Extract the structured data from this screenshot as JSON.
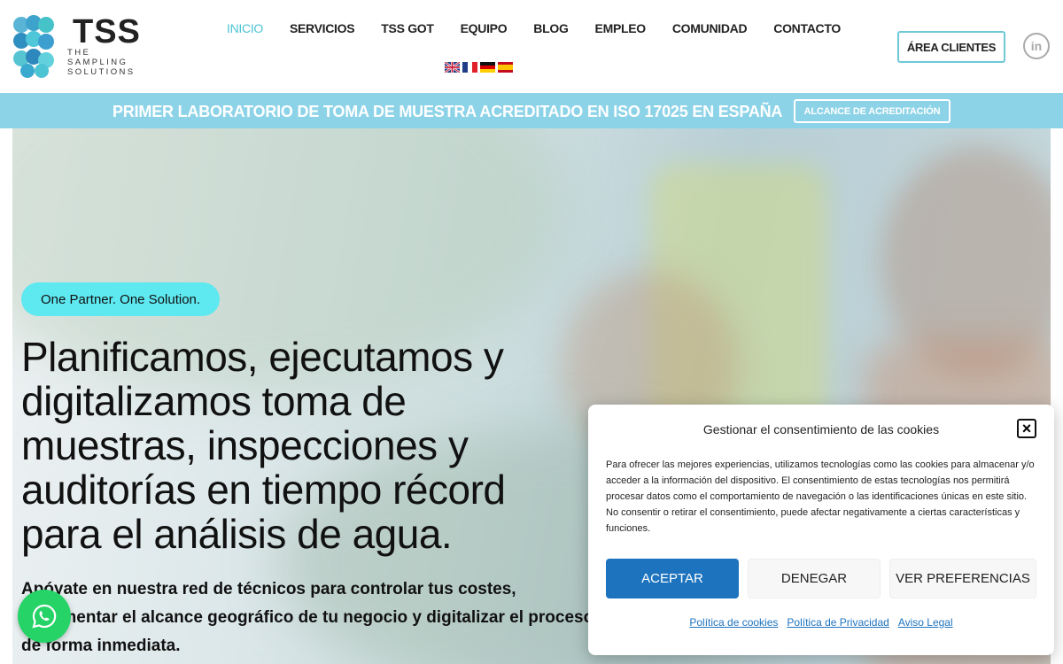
{
  "logo": {
    "name": "TSS",
    "tagline_lines": [
      "THE",
      "SAMPLING",
      "SOLUTIONS"
    ]
  },
  "nav": {
    "items": [
      {
        "label": "INICIO",
        "active": true
      },
      {
        "label": "SERVICIOS"
      },
      {
        "label": "TSS GOT"
      },
      {
        "label": "EQUIPO"
      },
      {
        "label": "BLOG"
      },
      {
        "label": "EMPLEO"
      },
      {
        "label": "COMUNIDAD"
      },
      {
        "label": "CONTACTO"
      }
    ],
    "languages": [
      "en",
      "fr",
      "de",
      "es"
    ]
  },
  "header": {
    "client_area_label": "ÁREA CLIENTES",
    "linkedin_label": "in"
  },
  "banner": {
    "text": "PRIMER LABORATORIO DE TOMA DE MUESTRA ACREDITADO EN ISO 17025 EN ESPAÑA",
    "button_label": "ALCANCE DE ACREDITACIÓN"
  },
  "hero": {
    "tag": "One Partner. One Solution.",
    "headline": "Planificamos, ejecutamos y digitalizamos toma de muestras, inspecciones y auditorías en tiempo récord para el análisis de agua.",
    "subhead": "Apóyate en nuestra red de técnicos para controlar tus costes, incrementar el alcance geográfico de tu negocio y digitalizar el proceso de forma inmediata."
  },
  "cookie": {
    "title": "Gestionar el consentimiento de las cookies",
    "body": "Para ofrecer las mejores experiencias, utilizamos tecnologías como las cookies para almacenar y/o acceder a la información del dispositivo. El consentimiento de estas tecnologías nos permitirá procesar datos como el comportamiento de navegación o las identificaciones únicas en este sitio. No consentir o retirar el consentimiento, puede afectar negativamente a ciertas características y funciones.",
    "accept_label": "ACEPTAR",
    "deny_label": "DENEGAR",
    "prefs_label": "VER PREFERENCIAS",
    "links": [
      "Política de cookies",
      "Política de Privacidad",
      "Aviso Legal"
    ]
  },
  "colors": {
    "accent": "#4cc4d4",
    "banner": "#8dd3e8",
    "tag": "#5ee8f0",
    "accept": "#1e73be",
    "whatsapp": "#25d366"
  }
}
